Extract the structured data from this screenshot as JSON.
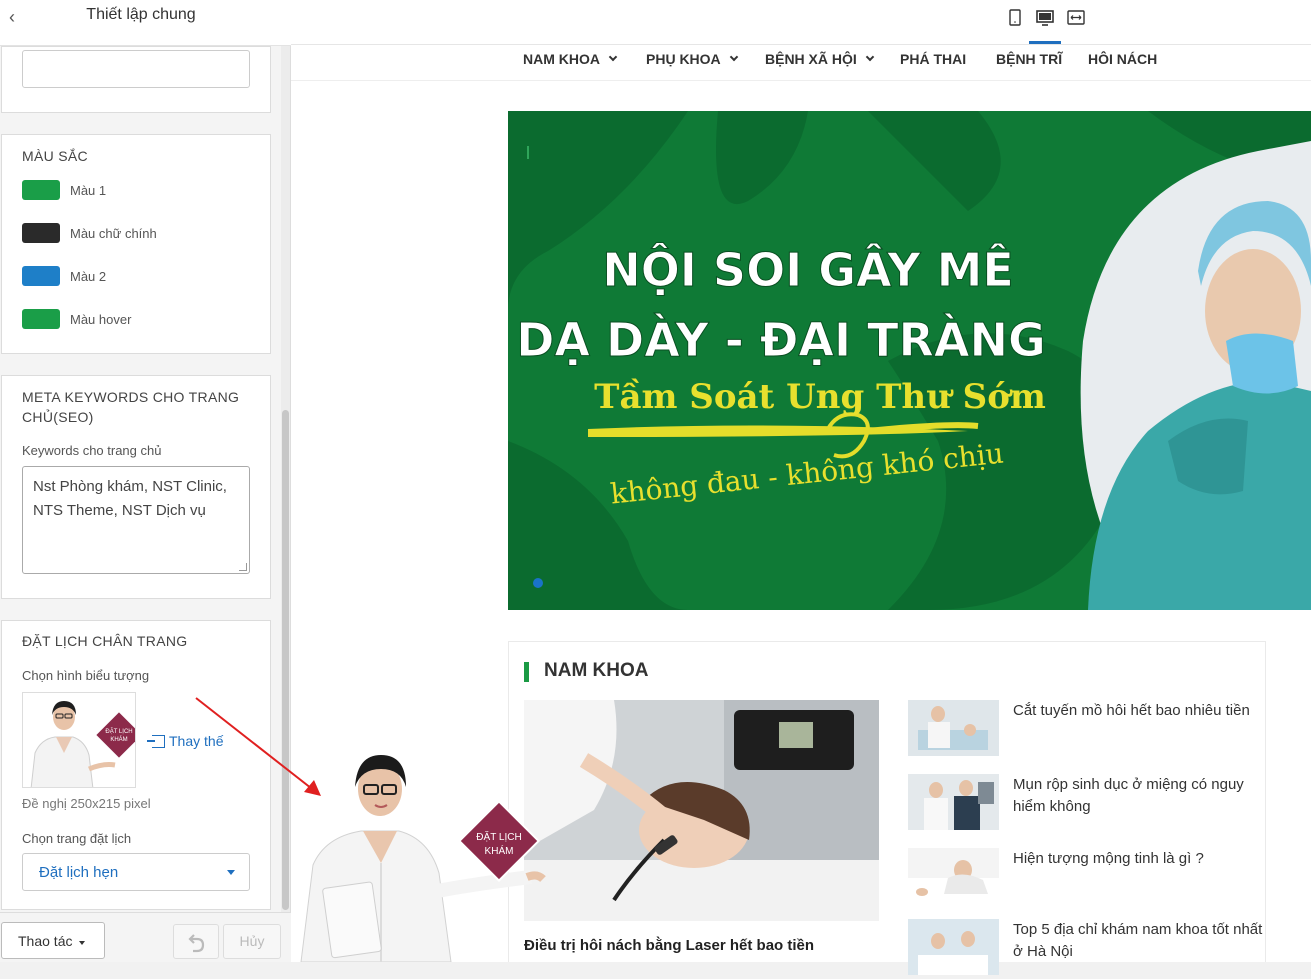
{
  "sidebar": {
    "title": "Thiết lập chung",
    "colors_section": {
      "title": "MÀU SẮC",
      "items": [
        {
          "label": "Màu 1",
          "color": "#1a9e48"
        },
        {
          "label": "Màu chữ chính",
          "color": "#2a2a2a"
        },
        {
          "label": "Màu 2",
          "color": "#1e7fc8"
        },
        {
          "label": "Màu hover",
          "color": "#1a9e48"
        }
      ]
    },
    "meta_section": {
      "title": "META KEYWORDS CHO TRANG CHỦ(SEO)",
      "field_label": "Keywords cho trang chủ",
      "value": "Nst Phòng khám, NST Clinic, NTS Theme, NST Dịch vụ"
    },
    "booking_section": {
      "title": "ĐẶT LỊCH CHÂN TRANG",
      "icon_label": "Chọn hình biểu tượng",
      "replace_label": "Thay thế",
      "hint": "Đề nghị 250x215 pixel",
      "page_label": "Chọn trang đặt lịch",
      "page_value": "Đặt lịch hẹn",
      "badge_line1": "ĐẶT LỊCH",
      "badge_line2": "KHÁM"
    },
    "footer": {
      "action_label": "Thao tác",
      "cancel_label": "Hủy"
    }
  },
  "preview": {
    "nav": [
      {
        "label": "NAM KHOA",
        "dropdown": true
      },
      {
        "label": "PHỤ KHOA",
        "dropdown": true
      },
      {
        "label": "BỆNH XÃ HỘI",
        "dropdown": true
      },
      {
        "label": "PHÁ THAI",
        "dropdown": false
      },
      {
        "label": "BỆNH TRĨ",
        "dropdown": false
      },
      {
        "label": "HÔI NÁCH",
        "dropdown": false
      }
    ],
    "banner": {
      "line1": "NỘI SOI GÂY MÊ",
      "line2": "DẠ DÀY - ĐẠI TRÀNG",
      "line3": "Tầm Soát Ung Thư Sớm",
      "line4": "không đau - không khó chịu"
    },
    "section": {
      "title": "NAM KHOA",
      "main_caption": "Điều trị hôi nách bằng Laser hết bao tiền",
      "list": [
        "Cắt tuyến mồ hôi hết bao nhiêu tiền",
        "Mụn rộp sinh dục ở miệng có nguy hiểm không",
        "Hiện tượng mộng tinh là gì ?",
        "Top 5 địa chỉ khám nam khoa tốt nhất ở Hà Nội"
      ]
    },
    "float_badge_line1": "ĐẶT LỊCH",
    "float_badge_line2": "KHÁM"
  },
  "colors": {
    "accent_green": "#1a9e48",
    "link_blue": "#1f6fbf",
    "badge_maroon": "#8c2a4a"
  }
}
